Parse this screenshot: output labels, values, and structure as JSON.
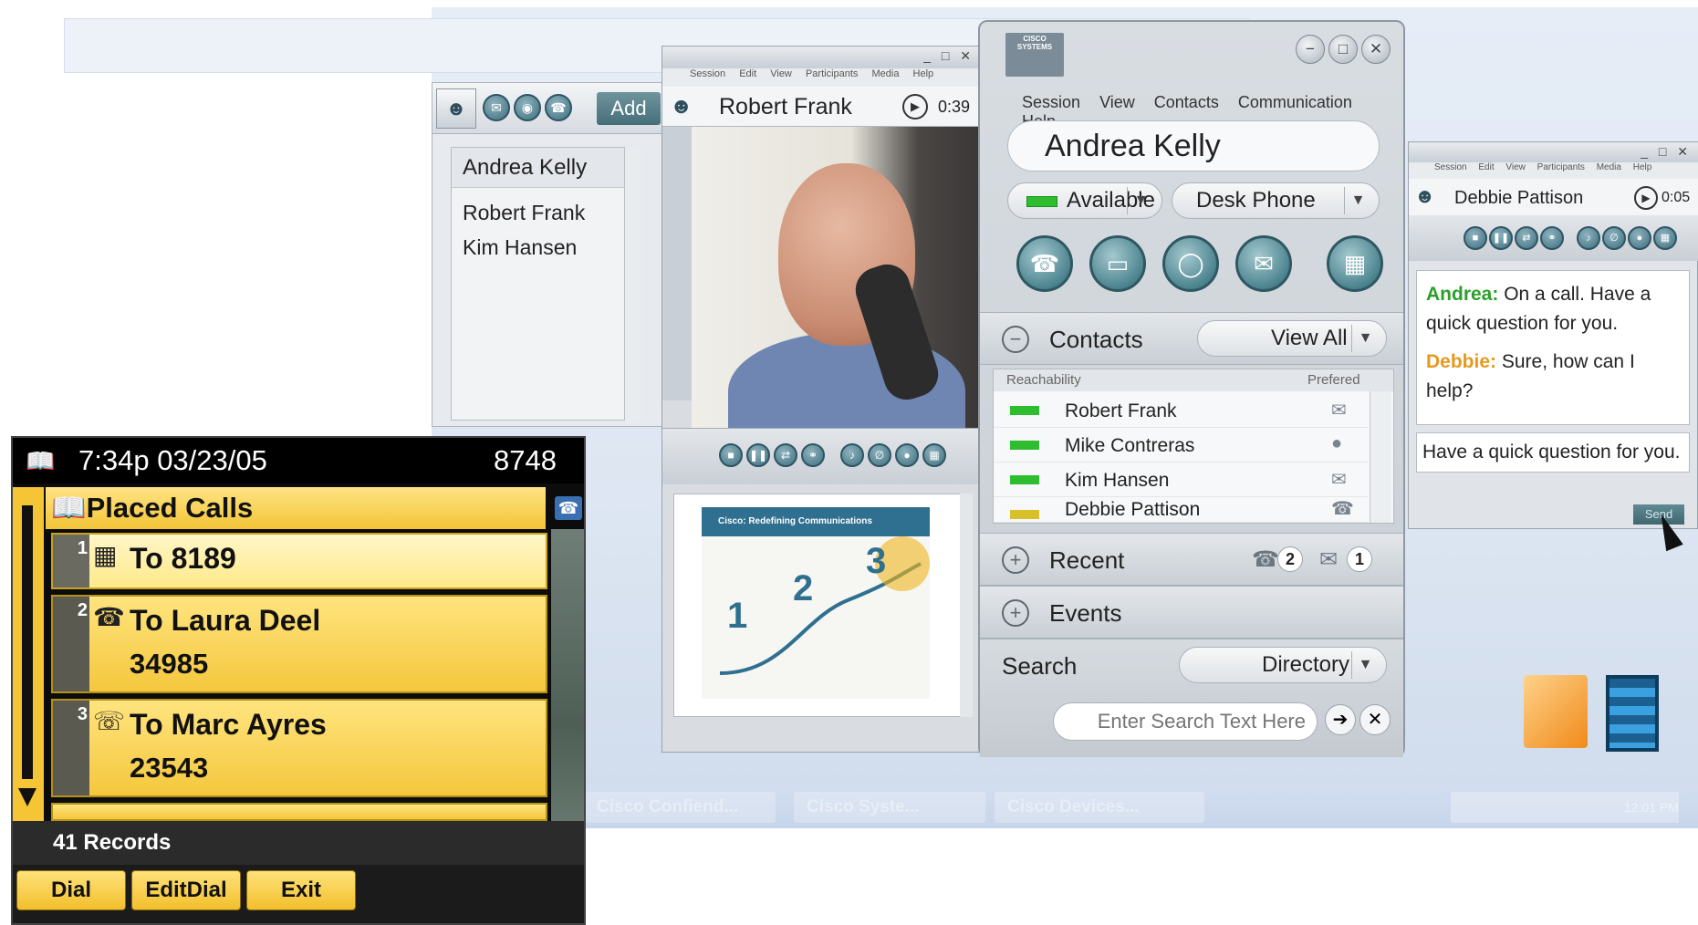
{
  "taskbar": {
    "items": [
      "Cisco Confiend...",
      "Cisco Syste...",
      "Cisco Devices..."
    ],
    "clock": "12:01 PM"
  },
  "buddy_window": {
    "add_label": "Add",
    "selected": "Andrea Kelly",
    "items": [
      "Robert Frank",
      "Kim Hansen"
    ]
  },
  "video_window": {
    "menu": [
      "Session",
      "Edit",
      "View",
      "Participants",
      "Media",
      "Help"
    ],
    "contact_name": "Robert Frank",
    "timer": "0:39",
    "slide_title": "Cisco: Redefining Communications"
  },
  "main_window": {
    "brand": "CISCO SYSTEMS",
    "menu": [
      "Session",
      "View",
      "Contacts",
      "Communication",
      "Help"
    ],
    "user_name": "Andrea Kelly",
    "status": "Available",
    "device": "Desk Phone",
    "contacts_label": "Contacts",
    "view_filter": "View All",
    "table_headers": {
      "reachability": "Reachability",
      "preferred": "Prefered"
    },
    "contacts": [
      {
        "name": "Robert Frank",
        "status_color": "#2ebd2e",
        "pref_icon": "mail-icon"
      },
      {
        "name": "Mike Contreras",
        "status_color": "#2ebd2e",
        "pref_icon": "chat-icon"
      },
      {
        "name": "Kim Hansen",
        "status_color": "#2ebd2e",
        "pref_icon": "mail-icon"
      },
      {
        "name": "Debbie Pattison",
        "status_color": "#d8c02a",
        "pref_icon": "phone-icon"
      }
    ],
    "recent_label": "Recent",
    "recent_calls": "2",
    "recent_messages": "1",
    "events_label": "Events",
    "search_label": "Search",
    "search_scope": "Directory",
    "search_placeholder": "Enter Search Text Here"
  },
  "chat_window": {
    "menu": [
      "Session",
      "Edit",
      "View",
      "Participants",
      "Media",
      "Help"
    ],
    "contact_name": "Debbie Pattison",
    "timer": "0:05",
    "messages": [
      {
        "sender": "Andrea:",
        "text": "On a call. Have a quick question for you."
      },
      {
        "sender": "Debbie:",
        "text": "Sure, how can I help?"
      }
    ],
    "input_text": "Have a quick question for you.",
    "send_label": "Send"
  },
  "phone": {
    "time": "7:34p 03/23/05",
    "extension": "8748",
    "title": "Placed Calls",
    "calls": [
      {
        "index": "1",
        "label": "To 8189",
        "number": "",
        "icon": "keypad-icon"
      },
      {
        "index": "2",
        "label": "To Laura Deel",
        "number": "34985",
        "icon": "phone-icon"
      },
      {
        "index": "3",
        "label": "To Marc Ayres",
        "number": "23543",
        "icon": "forward-phone-icon"
      }
    ],
    "records": "41 Records",
    "softkeys": [
      "Dial",
      "EditDial",
      "Exit"
    ]
  }
}
